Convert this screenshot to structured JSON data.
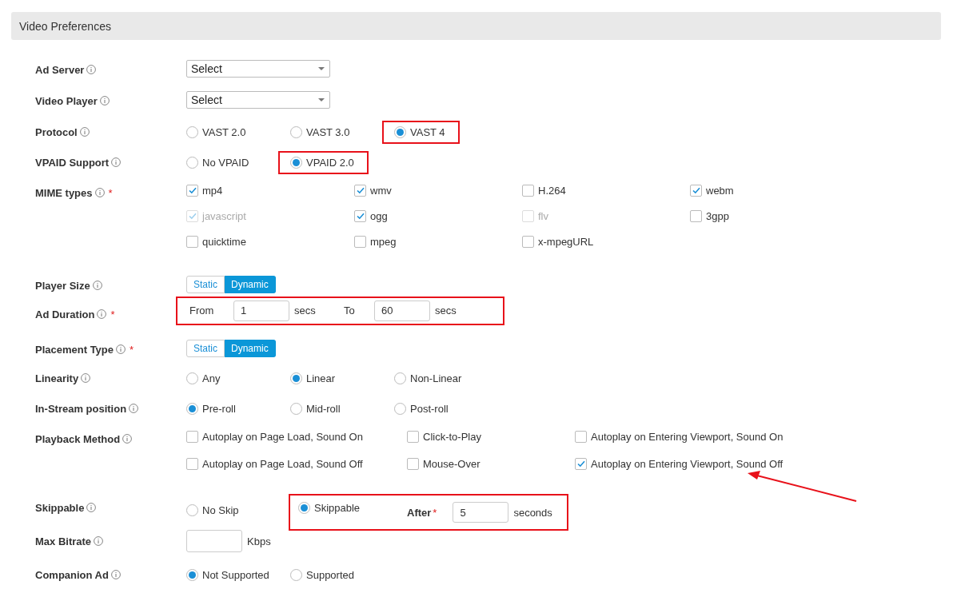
{
  "header": {
    "title": "Video Preferences"
  },
  "rows": [
    {
      "kind": "select",
      "label": "Ad Server",
      "value": "Select"
    },
    {
      "kind": "select",
      "label": "Video Player",
      "value": "Select"
    },
    {
      "kind": "radio",
      "label": "Protocol",
      "options": [
        {
          "label": "VAST 2.0",
          "selected": false,
          "highlighted": false
        },
        {
          "label": "VAST 3.0",
          "selected": false,
          "highlighted": false
        },
        {
          "label": "VAST 4",
          "selected": true,
          "highlighted": true
        }
      ]
    },
    {
      "kind": "radio",
      "label": "VPAID Support",
      "options": [
        {
          "label": "No VPAID",
          "selected": false,
          "highlighted": false
        },
        {
          "label": "VPAID 2.0",
          "selected": true,
          "highlighted": true
        }
      ]
    },
    {
      "kind": "checkbox",
      "label": "MIME types",
      "required_mark": "*",
      "options": [
        {
          "label": "mp4",
          "checked": true,
          "disabled": false,
          "arrow": false
        },
        {
          "label": "wmv",
          "checked": true,
          "disabled": false,
          "arrow": false
        },
        {
          "label": "H.264",
          "checked": false,
          "disabled": false,
          "arrow": false
        },
        {
          "label": "webm",
          "checked": true,
          "disabled": false,
          "arrow": false
        },
        {
          "label": "javascript",
          "checked": true,
          "disabled": true,
          "arrow": false
        },
        {
          "label": "ogg",
          "checked": true,
          "disabled": false,
          "arrow": false
        },
        {
          "label": "flv",
          "checked": false,
          "disabled": true,
          "arrow": false
        },
        {
          "label": "3gpp",
          "checked": false,
          "disabled": false,
          "arrow": false
        },
        {
          "label": "quicktime",
          "checked": false,
          "disabled": false,
          "arrow": false
        },
        {
          "label": "mpeg",
          "checked": false,
          "disabled": false,
          "arrow": false
        },
        {
          "label": "x-mpegURL",
          "checked": false,
          "disabled": false,
          "arrow": false
        }
      ]
    },
    {
      "kind": "toggle",
      "label": "Player Size",
      "options": [
        {
          "label": "Static",
          "selected": false
        },
        {
          "label": "Dynamic",
          "selected": true
        }
      ]
    },
    {
      "kind": "range",
      "label": "Ad Duration",
      "required_mark": "*",
      "highlighted": true,
      "from_label": "From",
      "from_value": "1",
      "from_unit": "secs",
      "to_label": "To",
      "to_value": "60",
      "to_unit": "secs"
    },
    {
      "kind": "toggle",
      "label": "Placement Type",
      "required_mark": "*",
      "options": [
        {
          "label": "Static",
          "selected": false
        },
        {
          "label": "Dynamic",
          "selected": true
        }
      ]
    },
    {
      "kind": "radio",
      "label": "Linearity",
      "options": [
        {
          "label": "Any",
          "selected": false,
          "highlighted": false
        },
        {
          "label": "Linear",
          "selected": true,
          "highlighted": false
        },
        {
          "label": "Non-Linear",
          "selected": false,
          "highlighted": false
        }
      ]
    },
    {
      "kind": "radio",
      "label": "In-Stream position",
      "options": [
        {
          "label": "Pre-roll",
          "selected": true,
          "highlighted": false
        },
        {
          "label": "Mid-roll",
          "selected": false,
          "highlighted": false
        },
        {
          "label": "Post-roll",
          "selected": false,
          "highlighted": false
        }
      ]
    },
    {
      "kind": "checkbox",
      "label": "Playback Method",
      "options": [
        {
          "label": "Autoplay on Page Load, Sound On",
          "checked": false,
          "disabled": false,
          "arrow": false
        },
        {
          "label": "Click-to-Play",
          "checked": false,
          "disabled": false,
          "arrow": false
        },
        {
          "label": "Autoplay on Entering Viewport, Sound On",
          "checked": false,
          "disabled": false,
          "arrow": false
        },
        {
          "label": "Autoplay on Page Load, Sound Off",
          "checked": false,
          "disabled": false,
          "arrow": false
        },
        {
          "label": "Mouse-Over",
          "checked": false,
          "disabled": false,
          "arrow": false
        },
        {
          "label": "Autoplay on Entering Viewport, Sound Off",
          "checked": true,
          "disabled": false,
          "arrow": true
        }
      ]
    },
    {
      "kind": "skip",
      "label": "Skippable",
      "highlighted": true,
      "options": [
        {
          "label": "No Skip",
          "selected": false
        },
        {
          "label": "Skippable",
          "selected": true
        }
      ],
      "after_label": "After",
      "after_required_mark": "*",
      "after_value": "5",
      "after_unit": "seconds"
    },
    {
      "kind": "number",
      "label": "Max Bitrate",
      "value": "",
      "unit": "Kbps"
    },
    {
      "kind": "radio",
      "label": "Companion Ad",
      "options": [
        {
          "label": "Not Supported",
          "selected": true,
          "highlighted": false
        },
        {
          "label": "Supported",
          "selected": false,
          "highlighted": false
        }
      ]
    }
  ]
}
